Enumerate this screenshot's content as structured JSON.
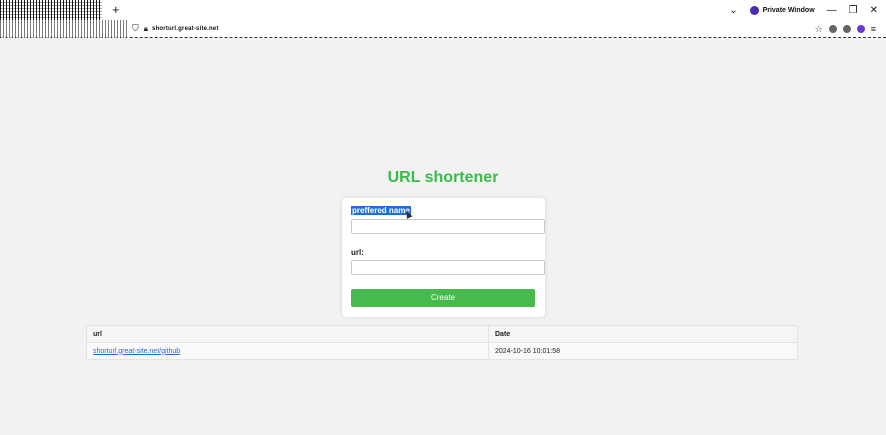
{
  "browser": {
    "new_tab": "+",
    "profile_name": "Private Window",
    "address": "shorturl.great-site.net",
    "minimize": "—",
    "chevron": "⌄"
  },
  "page": {
    "title": "URL shortener",
    "form": {
      "name_label": "preffered name",
      "name_value": "",
      "url_label": "url:",
      "url_value": "",
      "create_label": "Create"
    },
    "table": {
      "columns": [
        "url",
        "Date"
      ],
      "rows": [
        {
          "url": "shorturl.great-site.net/github",
          "date": "2024-10-16 10:01:58"
        }
      ]
    }
  },
  "colors": {
    "accent": "#3cba4a",
    "button": "#47b94d",
    "link": "#2b6cd6",
    "selection": "#1f6fd6"
  }
}
